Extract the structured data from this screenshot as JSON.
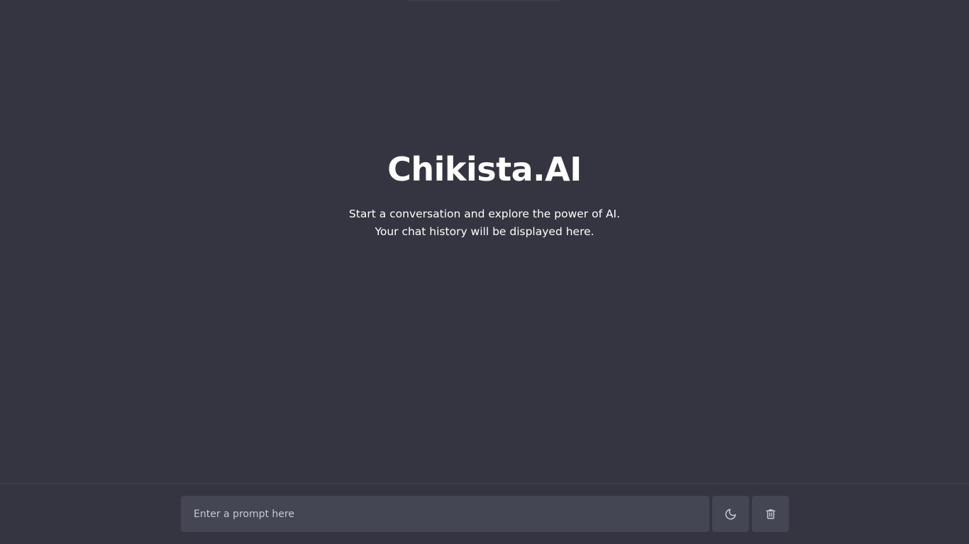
{
  "app": {
    "title": "Chikista.AI"
  },
  "welcome": {
    "line1": "Start a conversation and explore the power of AI.",
    "line2": "Your chat history will be displayed here."
  },
  "composer": {
    "placeholder": "Enter a prompt here",
    "value": ""
  },
  "actions": {
    "theme_toggle_icon": "moon-icon",
    "delete_chats_icon": "trash-icon"
  },
  "colors": {
    "background": "#353541",
    "input_background": "#444654",
    "text": "#ffffff",
    "placeholder": "#c9c9d3",
    "icon": "#c9c9d3"
  }
}
